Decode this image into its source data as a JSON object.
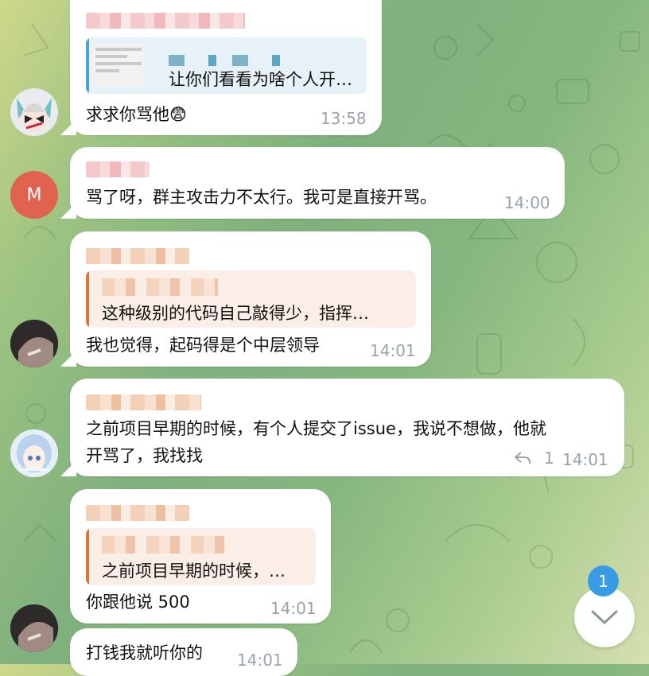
{
  "messages": [
    {
      "reply_text": "让你们看看为啥个人开…",
      "text": "求求你骂他😨",
      "time": "13:58"
    },
    {
      "text": "骂了呀，群主攻击力不太行。我可是直接开骂。",
      "time": "14:00",
      "avatar_letter": "M"
    },
    {
      "reply_text": "这种级别的代码自己敲得少，指挥…",
      "text": "我也觉得，起码得是个中层领导",
      "time": "14:01"
    },
    {
      "text_line1": "之前项目早期的时候，有个人提交了issue，我说不想做，他就",
      "text_line2": "开骂了，我找找",
      "reply_count": "1",
      "time": "14:01"
    },
    {
      "reply_text": "之前项目早期的时候，…",
      "text": "你跟他说 500",
      "time": "14:01"
    },
    {
      "text": "打钱我就听你的",
      "time": "14:01"
    }
  ],
  "unread_badge": "1",
  "colors": {
    "badge": "#3a9be5",
    "avatar_m": "#e0634f",
    "time": "#9aa3ad"
  }
}
